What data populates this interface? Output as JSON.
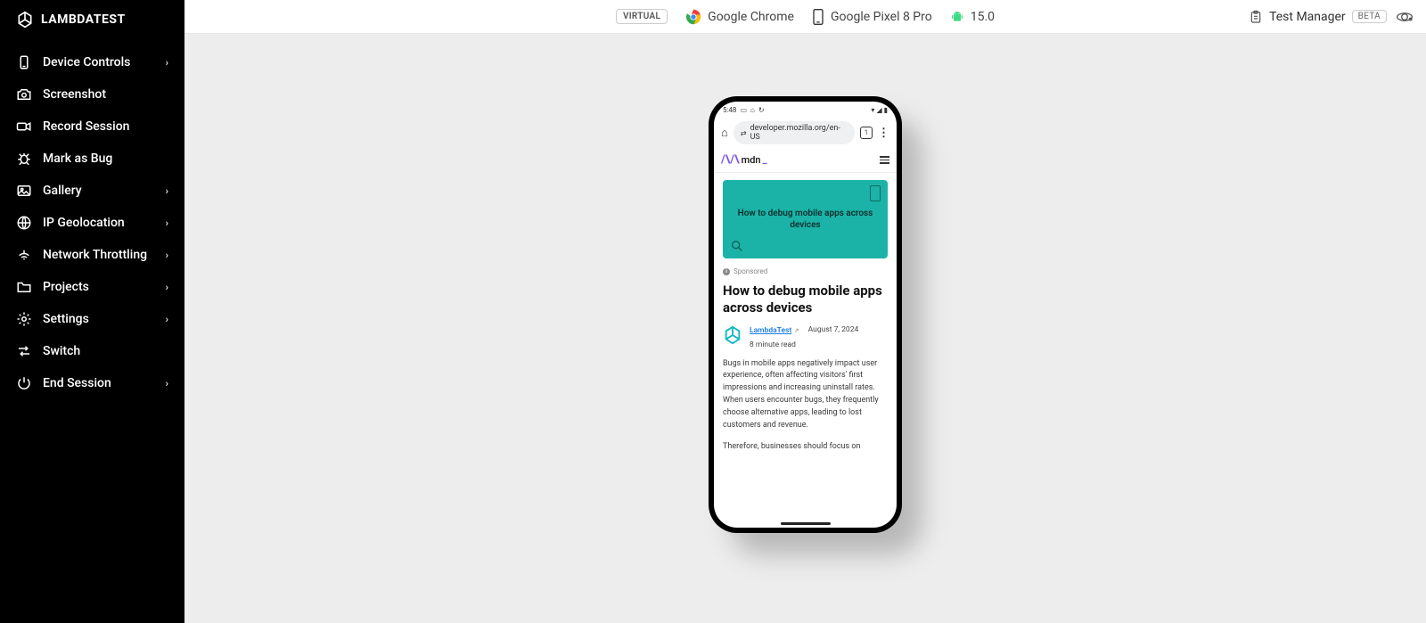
{
  "brand": {
    "name": "LAMBDATEST"
  },
  "sidebar": {
    "items": [
      {
        "label": "Device Controls",
        "icon": "device-icon",
        "chevron": true
      },
      {
        "label": "Screenshot",
        "icon": "camera-icon",
        "chevron": false
      },
      {
        "label": "Record Session",
        "icon": "record-icon",
        "chevron": false
      },
      {
        "label": "Mark as Bug",
        "icon": "bug-icon",
        "chevron": false
      },
      {
        "label": "Gallery",
        "icon": "gallery-icon",
        "chevron": true
      },
      {
        "label": "IP Geolocation",
        "icon": "globe-icon",
        "chevron": true
      },
      {
        "label": "Network Throttling",
        "icon": "signal-icon",
        "chevron": true
      },
      {
        "label": "Projects",
        "icon": "folder-icon",
        "chevron": true
      },
      {
        "label": "Settings",
        "icon": "gear-icon",
        "chevron": true
      },
      {
        "label": "Switch",
        "icon": "switch-icon",
        "chevron": false
      },
      {
        "label": "End Session",
        "icon": "power-icon",
        "chevron": true
      }
    ]
  },
  "topbar": {
    "virtual_badge": "VIRTUAL",
    "browser": "Google Chrome",
    "device": "Google Pixel 8 Pro",
    "os_version": "15.0",
    "test_manager": "Test Manager",
    "beta_badge": "BETA"
  },
  "device_screen": {
    "status_time": "5:48",
    "url": "developer.mozilla.org/en-US",
    "tab_count": "1",
    "site_logo_text": "mdn",
    "site_logo_cursor": "_",
    "hero_title": "How to debug mobile apps across devices",
    "sponsored_label": "Sponsored",
    "article_title": "How to debug mobile apps across devices",
    "author": "LambdaTest",
    "date": "August 7, 2024",
    "read_time": "8 minute read",
    "body1": "Bugs in mobile apps negatively impact user experience, often affecting visitors' first impressions and increasing uninstall rates. When users encounter bugs, they frequently choose alternative apps, leading to lost customers and revenue.",
    "body2": "Therefore, businesses should focus on"
  }
}
